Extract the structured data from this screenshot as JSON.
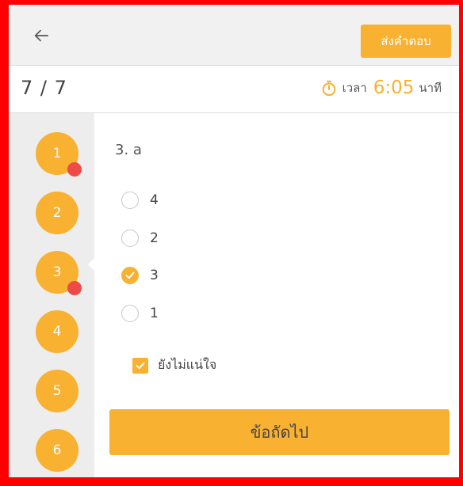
{
  "header": {
    "submit_label": "ส่งคำตอบ"
  },
  "status": {
    "counter": "7 / 7",
    "time_label": "เวลา",
    "time_value": "6:05",
    "time_unit": "นาที"
  },
  "sidebar": {
    "items": [
      {
        "label": "1",
        "flagged": true
      },
      {
        "label": "2",
        "flagged": false
      },
      {
        "label": "3",
        "flagged": true
      },
      {
        "label": "4",
        "flagged": false
      },
      {
        "label": "5",
        "flagged": false
      },
      {
        "label": "6",
        "flagged": false
      }
    ],
    "active_label": "3"
  },
  "question": {
    "title": "3. a",
    "options": [
      {
        "label": "4",
        "selected": false
      },
      {
        "label": "2",
        "selected": false
      },
      {
        "label": "3",
        "selected": true
      },
      {
        "label": "1",
        "selected": false
      }
    ],
    "unsure_label": "ยังไม่แน่ใจ",
    "unsure_checked": true
  },
  "footer": {
    "next_label": "ข้อถัดไป"
  },
  "colors": {
    "accent": "#f8b131",
    "flag": "#ed4b47",
    "frame": "#fe0000"
  }
}
